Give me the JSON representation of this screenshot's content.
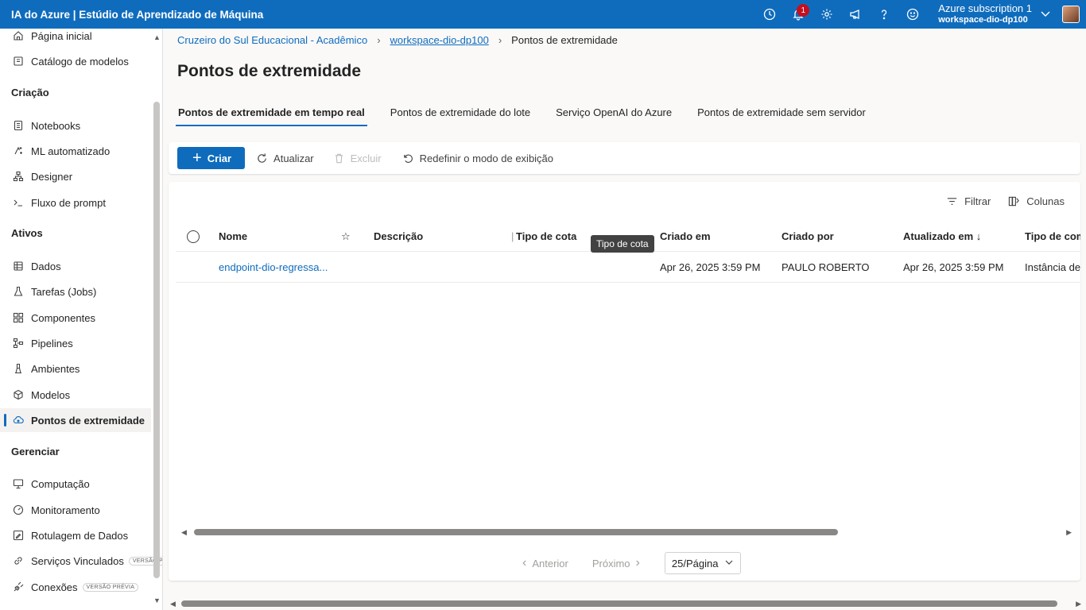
{
  "topbar": {
    "brand": "IA do Azure | Estúdio de Aprendizado de Máquina",
    "notification_count": "1",
    "subscription": "Azure subscription 1",
    "workspace": "workspace-dio-dp100",
    "icons": [
      "history-icon",
      "bell-icon",
      "gear-icon",
      "megaphone-icon",
      "help-icon",
      "smiley-icon",
      "chevron-down-icon"
    ]
  },
  "sidebar": {
    "top_items": [
      {
        "label": "Página inicial",
        "icon": "home-icon"
      },
      {
        "label": "Catálogo de modelos",
        "icon": "catalog-icon"
      }
    ],
    "sections": {
      "criacao": "Criação",
      "ativos": "Ativos",
      "gerenciar": "Gerenciar"
    },
    "criacao_items": [
      {
        "label": "Notebooks"
      },
      {
        "label": "ML automatizado"
      },
      {
        "label": "Designer"
      },
      {
        "label": "Fluxo de prompt"
      }
    ],
    "ativos_items": [
      {
        "label": "Dados"
      },
      {
        "label": "Tarefas (Jobs)"
      },
      {
        "label": "Componentes"
      },
      {
        "label": "Pipelines"
      },
      {
        "label": "Ambientes"
      },
      {
        "label": "Modelos"
      },
      {
        "label": "Pontos de extremidade"
      }
    ],
    "gerenciar_items": [
      {
        "label": "Computação"
      },
      {
        "label": "Monitoramento"
      },
      {
        "label": "Rotulagem de Dados"
      },
      {
        "label": "Serviços Vinculados",
        "badge": "VERSÃO P"
      },
      {
        "label": "Conexões",
        "badge": "VERSÃO PRÉVIA"
      }
    ]
  },
  "breadcrumb": {
    "org": "Cruzeiro do Sul Educacional - Acadêmico",
    "workspace": "workspace-dio-dp100",
    "current": "Pontos de extremidade"
  },
  "page_title": "Pontos de extremidade",
  "tabs": [
    {
      "label": "Pontos de extremidade em tempo real",
      "active": true
    },
    {
      "label": "Pontos de extremidade do lote"
    },
    {
      "label": "Serviço OpenAI do Azure"
    },
    {
      "label": "Pontos de extremidade sem servidor"
    }
  ],
  "toolbar": {
    "create": "Criar",
    "refresh": "Atualizar",
    "delete": "Excluir",
    "reset_view": "Redefinir o modo de exibição"
  },
  "panel_actions": {
    "filter": "Filtrar",
    "columns": "Colunas"
  },
  "table": {
    "headers": {
      "name": "Nome",
      "description": "Descrição",
      "quota_type": "Tipo de cota",
      "created_on": "Criado em",
      "created_by": "Criado por",
      "updated_on": "Atualizado em ↓",
      "compute_type": "Tipo de com"
    },
    "rows": [
      {
        "name": "endpoint-dio-regressa...",
        "description": "",
        "quota_type": "",
        "created_on": "Apr 26, 2025 3:59 PM",
        "created_by": "PAULO ROBERTO",
        "updated_on": "Apr 26, 2025 3:59 PM",
        "compute_type": "Instância de"
      }
    ],
    "tooltip": "Tipo de cota"
  },
  "pager": {
    "previous": "Anterior",
    "next": "Próximo",
    "page_size": "25/Página"
  },
  "colors": {
    "brand": "#0f6cbd",
    "badge": "#c50f1f"
  }
}
